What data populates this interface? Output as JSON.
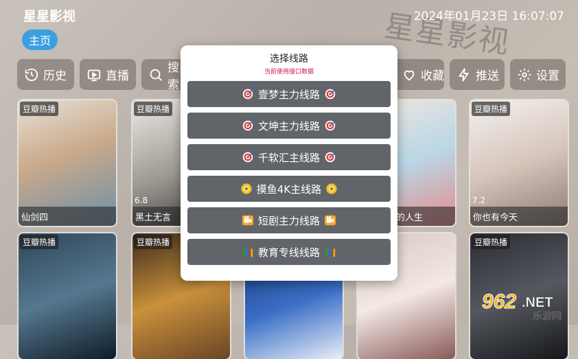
{
  "app": {
    "title": "星星影视",
    "clock": "2024年01月23日 16:07:07",
    "watermark": "星星影视"
  },
  "home_tab": "主页",
  "nav": {
    "history": "历史",
    "live": "直播",
    "search": "搜索",
    "favorites": "收藏",
    "push": "推送",
    "settings": "设置"
  },
  "cards": [
    {
      "badge": "豆瓣热播",
      "score": "",
      "title": "仙剑四",
      "colors": [
        "#e7e0d6",
        "#c9a98a",
        "#6d8fa9"
      ]
    },
    {
      "badge": "豆瓣热播",
      "score": "6.8",
      "title": "黑土无言",
      "colors": [
        "#ece9e4",
        "#9c9891",
        "#3a3836"
      ]
    },
    {
      "badge": "",
      "score": "",
      "title": "",
      "colors": [
        "#3b4451",
        "#6a7584",
        "#1f2630"
      ]
    },
    {
      "badge": "",
      "score": "",
      "title": "",
      "colors": [
        "#cfe1e8",
        "#a5c7d6",
        "#5d7a88"
      ]
    },
    {
      "badge": "",
      "score": "",
      "title": "这就是我的人生",
      "colors": [
        "#f1e6df",
        "#b9d7e6",
        "#e38c8a"
      ]
    },
    {
      "badge": "豆瓣热播",
      "score": "7.2",
      "title": "你也有今天",
      "colors": [
        "#f4f1ee",
        "#d6c6bc",
        "#8a7b74"
      ]
    },
    {
      "badge": "豆瓣热播",
      "score": "",
      "title": "",
      "colors": [
        "#2f4658",
        "#55788f",
        "#0f1d28"
      ]
    },
    {
      "badge": "豆瓣热播",
      "score": "",
      "title": "",
      "colors": [
        "#3d2a1b",
        "#c9913c",
        "#6a4426"
      ]
    },
    {
      "badge": "",
      "score": "",
      "title": "",
      "colors": [
        "#0d2a64",
        "#3a6fc6",
        "#e8eef8"
      ]
    },
    {
      "badge": "",
      "score": "",
      "title": "",
      "colors": [
        "#d9c7c2",
        "#f2e8e4",
        "#8a5a58"
      ]
    },
    {
      "badge": "豆瓣热播",
      "score": "",
      "title": "",
      "colors": [
        "#2b2d33",
        "#55585e",
        "#15171b"
      ]
    }
  ],
  "dialog": {
    "title": "选择线路",
    "subtitle": "当前使用接口数据",
    "routes": [
      {
        "label": "壹梦主力线路",
        "icon": "target-icon"
      },
      {
        "label": "文坤主力线路",
        "icon": "target-icon"
      },
      {
        "label": "千软汇主线路",
        "icon": "target-icon"
      },
      {
        "label": "摸鱼4K主线路",
        "icon": "disc-icon"
      },
      {
        "label": "短剧主力线路",
        "icon": "camera-icon"
      },
      {
        "label": "教育专线线路",
        "icon": "books-icon"
      }
    ]
  },
  "site_logo": {
    "number": "962",
    "suffix": ".NET",
    "sub": "乐游网"
  }
}
